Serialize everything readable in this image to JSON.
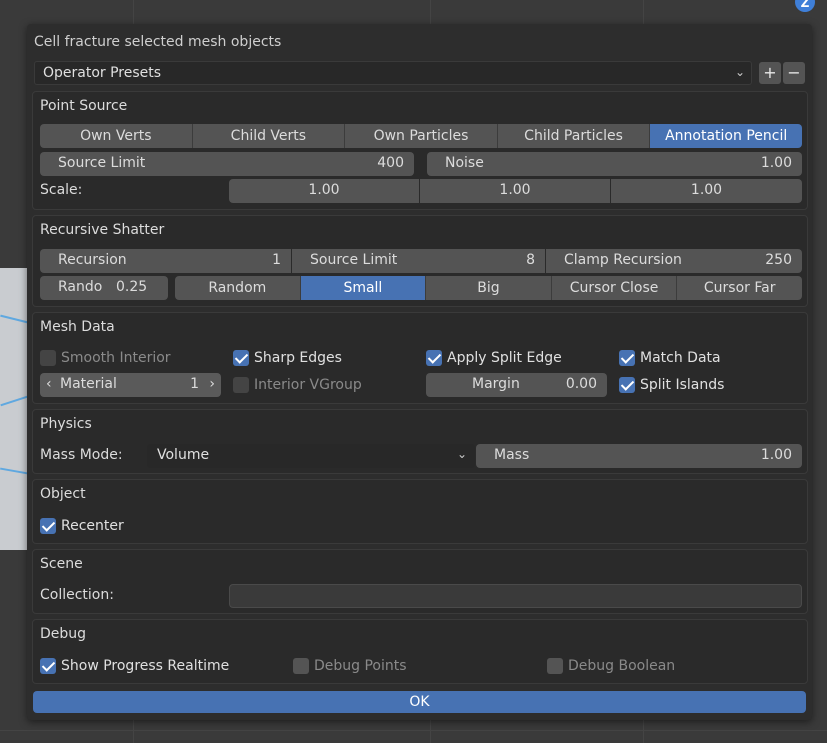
{
  "dialog": {
    "title": "Cell fracture selected mesh objects"
  },
  "presets": {
    "label": "Operator Presets",
    "add": "+",
    "remove": "−"
  },
  "point_source": {
    "title": "Point Source",
    "options": [
      "Own Verts",
      "Child Verts",
      "Own Particles",
      "Child Particles",
      "Annotation Pencil"
    ],
    "active": "Annotation Pencil",
    "source_limit": {
      "label": "Source Limit",
      "value": "400"
    },
    "noise": {
      "label": "Noise",
      "value": "1.00"
    },
    "scale": {
      "label": "Scale:",
      "x": "1.00",
      "y": "1.00",
      "z": "1.00"
    }
  },
  "recursive_shatter": {
    "title": "Recursive Shatter",
    "recursion": {
      "label": "Recursion",
      "value": "1"
    },
    "source_limit": {
      "label": "Source Limit",
      "value": "8"
    },
    "clamp_recursion": {
      "label": "Clamp Recursion",
      "value": "250"
    },
    "random": {
      "label": "Rando",
      "value": "0.25"
    },
    "options": [
      "Random",
      "Small",
      "Big",
      "Cursor Close",
      "Cursor Far"
    ],
    "active": "Small"
  },
  "mesh_data": {
    "title": "Mesh Data",
    "smooth_interior": {
      "label": "Smooth Interior",
      "checked": false
    },
    "sharp_edges": {
      "label": "Sharp Edges",
      "checked": true
    },
    "apply_split_edge": {
      "label": "Apply Split Edge",
      "checked": true
    },
    "match_data": {
      "label": "Match Data",
      "checked": true
    },
    "material": {
      "label": "Material",
      "value": "1"
    },
    "interior_vgroup": {
      "label": "Interior VGroup",
      "checked": false
    },
    "margin": {
      "label": "Margin",
      "value": "0.00"
    },
    "split_islands": {
      "label": "Split Islands",
      "checked": true
    }
  },
  "physics": {
    "title": "Physics",
    "mass_mode_label": "Mass Mode:",
    "mass_mode_value": "Volume",
    "mass": {
      "label": "Mass",
      "value": "1.00"
    }
  },
  "object": {
    "title": "Object",
    "recenter": {
      "label": "Recenter",
      "checked": true
    }
  },
  "scene": {
    "title": "Scene",
    "collection_label": "Collection:",
    "collection_value": ""
  },
  "debug": {
    "title": "Debug",
    "show_progress": {
      "label": "Show Progress Realtime",
      "checked": true
    },
    "debug_points": {
      "label": "Debug Points",
      "checked": false
    },
    "debug_boolean": {
      "label": "Debug Boolean",
      "checked": false
    }
  },
  "ok_label": "OK",
  "gizmo_axis": "Z",
  "colors": {
    "accent": "#4772b3",
    "panel": "#2a2a2a",
    "field": "#545454"
  }
}
